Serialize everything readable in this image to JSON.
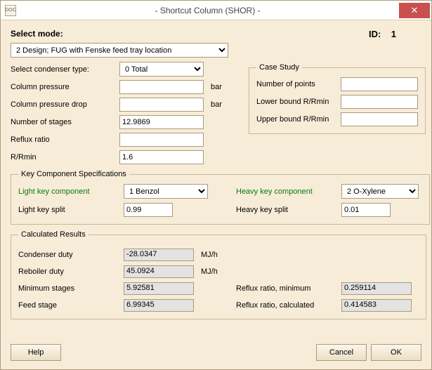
{
  "window": {
    "title": "- Shortcut Column (SHOR) -",
    "icon_text": "DOC"
  },
  "header": {
    "select_mode_label": "Select mode:",
    "mode_value": "2 Design; FUG with Fenske feed tray location",
    "id_label": "ID:",
    "id_value": "1"
  },
  "top": {
    "condenser_type_label": "Select condenser type:",
    "condenser_type_value": "0 Total",
    "column_pressure_label": "Column pressure",
    "column_pressure_value": "",
    "column_pressure_unit": "bar",
    "column_pressure_drop_label": "Column pressure drop",
    "column_pressure_drop_value": "",
    "column_pressure_drop_unit": "bar",
    "num_stages_label": "Number of stages",
    "num_stages_value": "12.9869",
    "reflux_ratio_label": "Reflux ratio",
    "reflux_ratio_value": "",
    "r_rmin_label": "R/Rmin",
    "r_rmin_value": "1.6"
  },
  "case_study": {
    "legend": "Case Study",
    "num_points_label": "Number of points",
    "num_points_value": "",
    "lower_label": "Lower bound R/Rmin",
    "lower_value": "",
    "upper_label": "Upper bound R/Rmin",
    "upper_value": ""
  },
  "key_spec": {
    "legend": "Key Component Specifications",
    "light_comp_label": "Light key component",
    "light_comp_value": "1 Benzol",
    "light_split_label": "Light key split",
    "light_split_value": "0.99",
    "heavy_comp_label": "Heavy key component",
    "heavy_comp_value": "2 O-Xylene",
    "heavy_split_label": "Heavy key split",
    "heavy_split_value": "0.01"
  },
  "results": {
    "legend": "Calculated Results",
    "cond_duty_label": "Condenser duty",
    "cond_duty_value": "-28.0347",
    "cond_duty_unit": "MJ/h",
    "reb_duty_label": "Reboiler duty",
    "reb_duty_value": "45.0924",
    "reb_duty_unit": "MJ/h",
    "min_stages_label": "Minimum stages",
    "min_stages_value": "5.92581",
    "feed_stage_label": "Feed stage",
    "feed_stage_value": "6.99345",
    "rr_min_label": "Reflux ratio, minimum",
    "rr_min_value": "0.259114",
    "rr_calc_label": "Reflux ratio, calculated",
    "rr_calc_value": "0.414583"
  },
  "buttons": {
    "help": "Help",
    "cancel": "Cancel",
    "ok": "OK"
  }
}
